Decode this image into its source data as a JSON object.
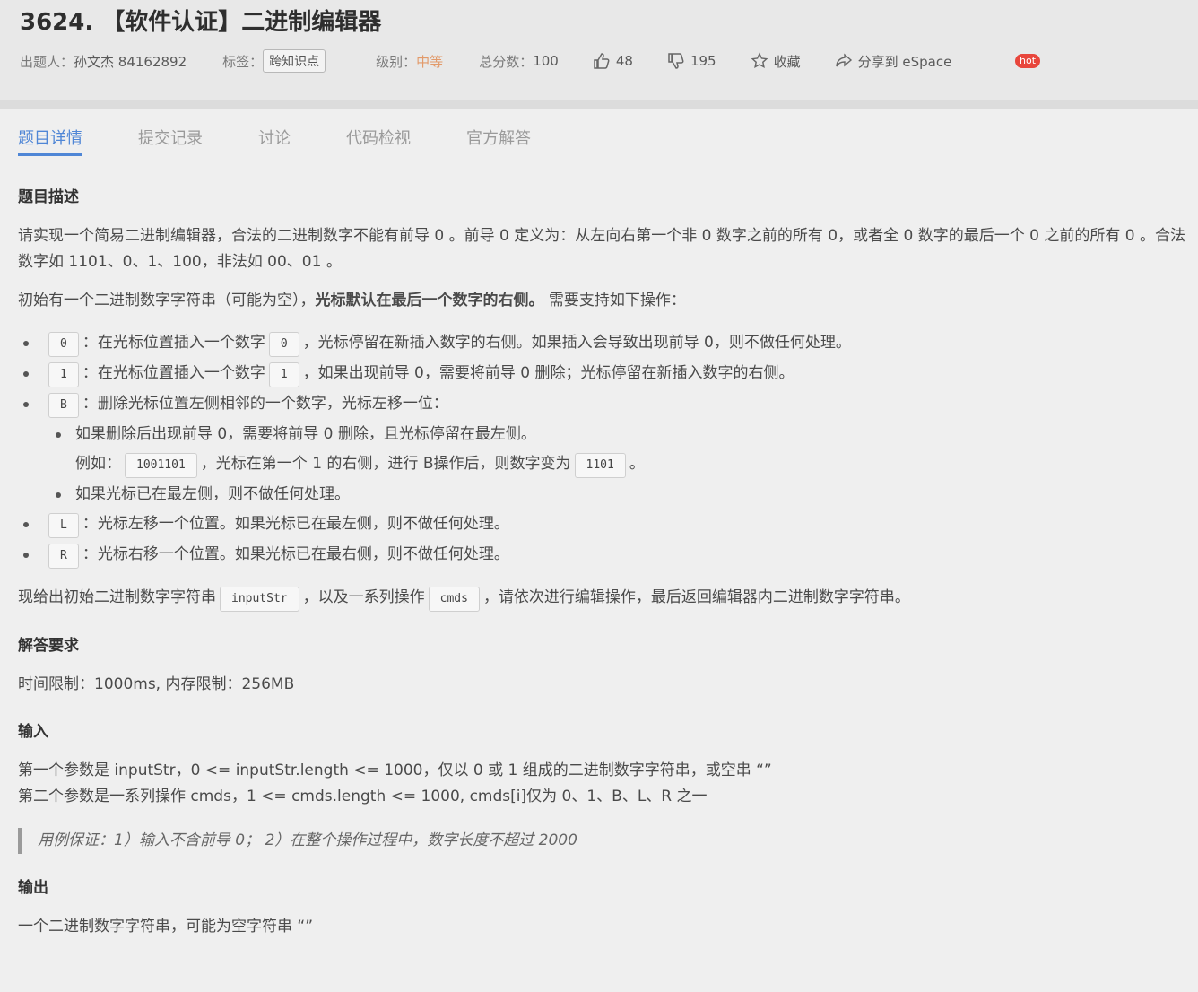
{
  "problem": {
    "title": "3624. 【软件认证】二进制编辑器",
    "author_label": "出题人：",
    "author": "孙文杰 84162892",
    "tag_label": "标签：",
    "tag": "跨知识点",
    "level_label": "级别：",
    "level": "中等",
    "score_label": "总分数：",
    "score": "100",
    "likes": "48",
    "dislikes": "195",
    "favorite": "收藏",
    "share": "分享到 eSpace",
    "hot": "hot"
  },
  "tabs": [
    {
      "label": "题目详情",
      "active": true
    },
    {
      "label": "提交记录",
      "active": false
    },
    {
      "label": "讨论",
      "active": false
    },
    {
      "label": "代码检视",
      "active": false
    },
    {
      "label": "官方解答",
      "active": false
    }
  ],
  "description": {
    "heading": "题目描述",
    "p1": "请实现一个简易二进制编辑器，合法的二进制数字不能有前导 0 。前导 0 定义为：从左向右第一个非 0 数字之前的所有 0，或者全 0 数字的最后一个 0 之前的所有 0 。合法数字如 1101、0、1、100，非法如 00、01 。",
    "p2_a": "初始有一个二进制数字字符串（可能为空），",
    "p2_bold": "光标默认在最后一个数字的右侧。",
    "p2_b": " 需要支持如下操作：",
    "op0_code": "0",
    "op0_a": "：在光标位置插入一个数字",
    "op0_code2": "0",
    "op0_b": "，光标停留在新插入数字的右侧。如果插入会导致出现前导 0，则不做任何处理。",
    "op1_code": "1",
    "op1_a": "：在光标位置插入一个数字",
    "op1_code2": "1",
    "op1_b": "，如果出现前导 0，需要将前导 0 删除；光标停留在新插入数字的右侧。",
    "opB_code": "B",
    "opB_text": "：删除光标位置左侧相邻的一个数字，光标左移一位：",
    "opB_sub1": "如果删除后出现前导 0，需要将前导 0 删除，且光标停留在最左侧。",
    "example_a": "例如：",
    "example_code1": "1001101",
    "example_b": "，光标在第一个 1 的右侧，进行 B操作后，则数字变为",
    "example_code2": "1101",
    "example_c": "。",
    "opB_sub2": "如果光标已在最左侧，则不做任何处理。",
    "opL_code": "L",
    "opL_text": "：光标左移一个位置。如果光标已在最左侧，则不做任何处理。",
    "opR_code": "R",
    "opR_text": "：光标右移一个位置。如果光标已在最右侧，则不做任何处理。",
    "final_a": "现给出初始二进制数字字符串",
    "final_code1": "inputStr",
    "final_b": "，以及一系列操作",
    "final_code2": "cmds",
    "final_c": "，请依次进行编辑操作，最后返回编辑器内二进制数字字符串。"
  },
  "requirements": {
    "heading": "解答要求",
    "text": "时间限制：1000ms, 内存限制：256MB"
  },
  "input": {
    "heading": "输入",
    "line1": "第一个参数是 inputStr，0 <= inputStr.length <= 1000，仅以 0 或 1 组成的二进制数字字符串，或空串 “”",
    "line2": "第二个参数是一系列操作 cmds，1 <= cmds.length <= 1000, cmds[i]仅为 0、1、B、L、R 之一",
    "note": "用例保证：1）输入不含前导 0； 2）在整个操作过程中，数字长度不超过 2000"
  },
  "output": {
    "heading": "输出",
    "text": "一个二进制数字字符串，可能为空字符串 “”"
  },
  "colors": {
    "accent": "#4f86d6",
    "level": "#e29a6a",
    "hot": "#e8463c"
  }
}
